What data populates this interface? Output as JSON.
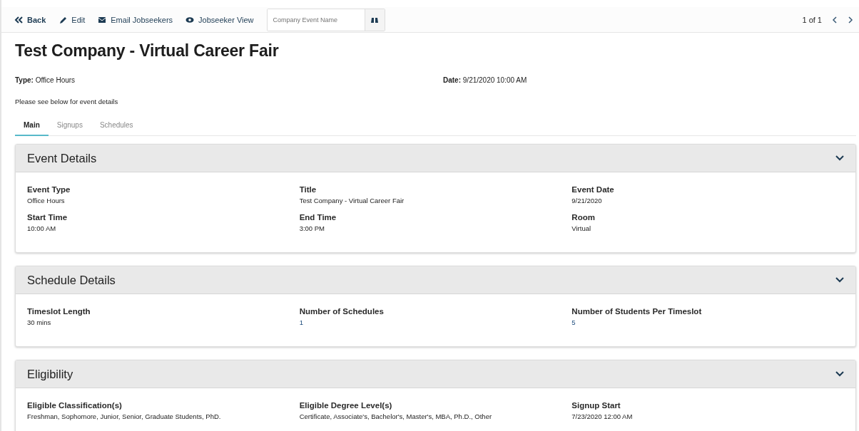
{
  "toolbar": {
    "actions": [
      {
        "kind": "back",
        "label": "Back"
      },
      {
        "kind": "edit",
        "label": "Edit"
      },
      {
        "kind": "email",
        "label": "Email Jobseekers"
      },
      {
        "kind": "view",
        "label": "Jobseeker View"
      }
    ],
    "search": {
      "placeholder": "Company Event Name"
    },
    "pager": "1 of 1"
  },
  "title": "Test Company - Virtual Career Fair",
  "summary": [
    {
      "label": "Type:",
      "value": "Office Hours"
    },
    {
      "label": "Date:",
      "value": "9/21/2020 10:00 AM"
    }
  ],
  "note": "Please see below for event details",
  "tabs": [
    {
      "label": "Main",
      "selected": true
    },
    {
      "label": "Signups",
      "selected": false
    },
    {
      "label": "Schedules",
      "selected": false
    }
  ],
  "panels": [
    {
      "title": "Event Details",
      "expanded": true,
      "fields": [
        {
          "label": "Event Type",
          "value": "Office Hours",
          "kind": "text"
        },
        {
          "label": "Title",
          "value": "Test Company - Virtual Career Fair",
          "kind": "text"
        },
        {
          "label": "Event Date",
          "value": "9/21/2020",
          "kind": "text"
        },
        {
          "label": "Start Time",
          "value": "10:00 AM",
          "kind": "text"
        },
        {
          "label": "End Time",
          "value": "3:00 PM",
          "kind": "text"
        },
        {
          "label": "Room",
          "value": "Virtual",
          "kind": "text"
        }
      ]
    },
    {
      "title": "Schedule Details",
      "expanded": true,
      "fields": [
        {
          "label": "Timeslot Length",
          "value": "30 mins",
          "kind": "text"
        },
        {
          "label": "Number of Schedules",
          "value": "1",
          "kind": "number"
        },
        {
          "label": "Number of Students Per Timeslot",
          "value": "5",
          "kind": "number"
        }
      ]
    },
    {
      "title": "Eligibility",
      "expanded": true,
      "fields": [
        {
          "label": "Eligible Classification(s)",
          "value": "Freshman, Sophomore, Junior, Senior, Graduate Students, PhD.",
          "kind": "text"
        },
        {
          "label": "Eligible Degree Level(s)",
          "value": "Certificate, Associate's, Bachelor's, Master's, MBA, Ph.D., Other",
          "kind": "text"
        },
        {
          "label": "Signup Start",
          "value": "7/23/2020 12:00 AM",
          "kind": "text"
        }
      ]
    }
  ]
}
